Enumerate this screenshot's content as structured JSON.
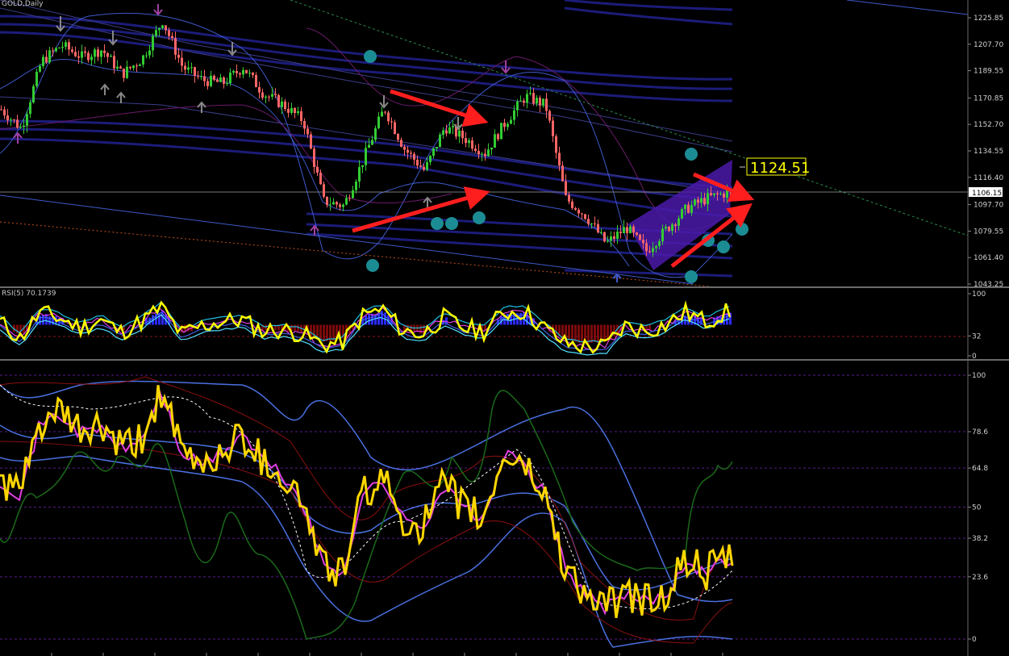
{
  "chart_title": "GOLD,Daily",
  "price_box": "1124.51",
  "current_price": "1106.15",
  "colors": {
    "background": "#000000",
    "bull_candle": "#33cc33",
    "bear_candle": "#ff6666",
    "price_line": "#ffff00",
    "rsi_line": "#ffff00",
    "arrow": "#ff1e1e",
    "channel": "#1c1c7a",
    "marker": "#1c8c94",
    "pitchfork": "#4a1aa8"
  },
  "chart_data": [
    {
      "type": "line",
      "title": "GOLD,Daily",
      "ylim": [
        1043.25,
        1225.85
      ],
      "y_ticks": [
        "1225.85",
        "1207.70",
        "1189.55",
        "1170.85",
        "1152.70",
        "1134.55",
        "1116.40",
        "1097.70",
        "1079.55",
        "1061.40",
        "1043.25"
      ],
      "x": [
        0,
        25,
        50,
        75,
        100,
        125,
        150,
        175,
        200,
        225,
        250,
        275,
        300,
        325,
        350,
        375,
        400,
        425,
        450,
        475,
        500,
        525,
        550,
        575,
        600,
        625,
        650,
        675,
        700,
        725,
        750,
        775,
        800,
        825,
        850,
        875,
        900
      ],
      "series": [
        {
          "values": [
            1163,
            1150,
            1196,
            1207,
            1199,
            1204,
            1187,
            1198,
            1224,
            1192,
            1183,
            1181,
            1192,
            1174,
            1166,
            1155,
            1100,
            1097,
            1130,
            1164,
            1136,
            1121,
            1151,
            1143,
            1133,
            1154,
            1172,
            1166,
            1102,
            1090,
            1071,
            1082,
            1066,
            1081,
            1095,
            1102,
            1106
          ]
        }
      ],
      "annotations": [
        "1124.51"
      ]
    },
    {
      "type": "line",
      "title": "RSI(5) 70.1739",
      "ylim": [
        0,
        100
      ],
      "y_ticks": [
        "100",
        "32",
        "0"
      ],
      "x": [
        0,
        25,
        50,
        75,
        100,
        125,
        150,
        175,
        200,
        225,
        250,
        275,
        300,
        325,
        350,
        375,
        400,
        425,
        450,
        475,
        500,
        525,
        550,
        575,
        600,
        625,
        650,
        675,
        700,
        725,
        750,
        775,
        800,
        825,
        850,
        875,
        900
      ],
      "series": [
        {
          "values": [
            55,
            28,
            70,
            60,
            45,
            58,
            38,
            55,
            78,
            35,
            48,
            55,
            58,
            40,
            42,
            35,
            18,
            22,
            65,
            75,
            40,
            35,
            62,
            45,
            40,
            70,
            72,
            45,
            20,
            15,
            15,
            48,
            40,
            50,
            70,
            55,
            70
          ]
        }
      ]
    },
    {
      "type": "line",
      "ylim": [
        0,
        100
      ],
      "y_ticks": [
        "100",
        "78.6",
        "64.8",
        "50",
        "38.2",
        "23.6",
        "0"
      ],
      "x": [
        0,
        25,
        50,
        75,
        100,
        125,
        150,
        175,
        200,
        225,
        250,
        275,
        300,
        325,
        350,
        375,
        400,
        425,
        450,
        475,
        500,
        525,
        550,
        575,
        600,
        625,
        650,
        675,
        700,
        725,
        750,
        775,
        800,
        825,
        850,
        875,
        900
      ],
      "series": [
        {
          "values": [
            60,
            55,
            82,
            85,
            78,
            80,
            72,
            75,
            94,
            70,
            66,
            70,
            78,
            68,
            62,
            52,
            28,
            25,
            55,
            60,
            45,
            43,
            58,
            50,
            45,
            70,
            66,
            55,
            28,
            17,
            12,
            16,
            15,
            16,
            30,
            25,
            30
          ]
        }
      ]
    }
  ]
}
